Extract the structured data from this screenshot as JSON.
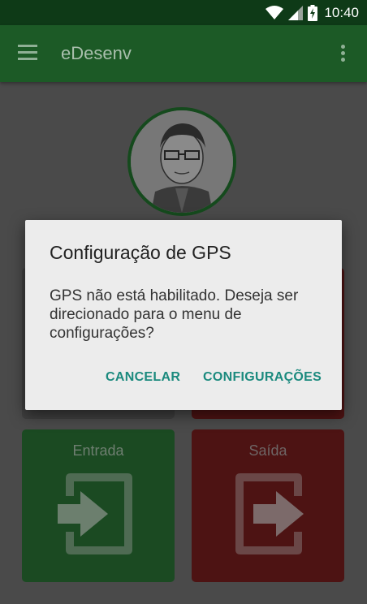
{
  "status_bar": {
    "time": "10:40",
    "icons": [
      "wifi-icon",
      "signal-icon",
      "battery-charging-icon"
    ]
  },
  "toolbar": {
    "title": "eDesenv",
    "menu_icon": "hamburger-menu-icon",
    "overflow_icon": "more-vert-icon"
  },
  "main": {
    "profile_avatar": "user-avatar",
    "tiles": [
      {
        "label": "Entrada",
        "icon": "login-icon",
        "color": "#1b4a22"
      },
      {
        "label": "Saída",
        "icon": "logout-icon",
        "color": "#4d1313"
      }
    ]
  },
  "dialog": {
    "title": "Configuração de GPS",
    "message": "GPS não está habilitado. Deseja ser direcionado para o menu de configurações?",
    "cancel_label": "CANCELAR",
    "confirm_label": "CONFIGURAÇÕES",
    "accent_color": "#1b8a7e"
  }
}
